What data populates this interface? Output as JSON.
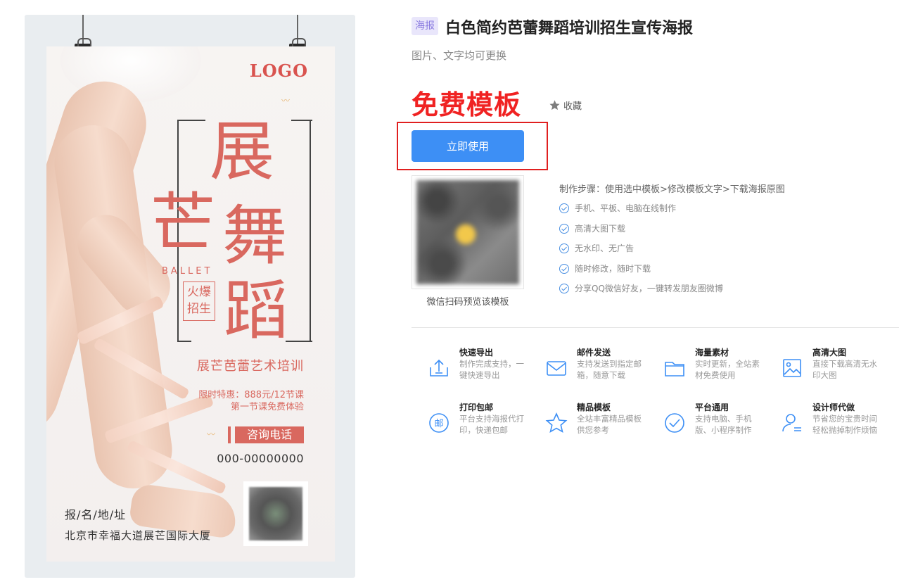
{
  "poster": {
    "logo": "LOGO",
    "title_chars": [
      "展",
      "芒",
      "舞",
      "蹈"
    ],
    "ballet": "BALLET",
    "hot_lines": [
      "火爆",
      "招生"
    ],
    "subtitle": "展芒芭蕾艺术培训",
    "promo_1": "限时特惠：888元/12节课",
    "promo_2": "第一节课免费体验",
    "tel_label": "咨询电话",
    "tel_number": "000-00000000",
    "addr_label": "报/名/地/址",
    "addr_text": "北京市幸福大道展芒国际大厦"
  },
  "info": {
    "tag": "海报",
    "title": "白色简约芭蕾舞蹈培训招生宣传海报",
    "subtitle": "图片、文字均可更换",
    "free_label": "免费模板",
    "fav_label": "收藏",
    "use_button": "立即使用",
    "qr_caption": "微信扫码预览该模板",
    "steps_head": "制作步骤：使用选中模板>修改模板文字>下载海报原图",
    "steps": [
      "手机、平板、电脑在线制作",
      "高清大图下载",
      "无水印、无广告",
      "随时修改，随时下载",
      "分享QQ微信好友，一键转发朋友圈微博"
    ]
  },
  "features": [
    {
      "title": "快速导出",
      "desc": "制作完成支持，一键快速导出",
      "icon": "export-icon"
    },
    {
      "title": "邮件发送",
      "desc": "支持发送到指定邮箱，随意下载",
      "icon": "mail-icon"
    },
    {
      "title": "海量素材",
      "desc": "实时更新，全站素材免费使用",
      "icon": "folder-icon"
    },
    {
      "title": "高清大图",
      "desc": "直接下载高清无水印大图",
      "icon": "image-icon"
    },
    {
      "title": "打印包邮",
      "desc": "平台支持海报代打印，快递包邮",
      "icon": "post-icon"
    },
    {
      "title": "精品模板",
      "desc": "全站丰富精品模板供您参考",
      "icon": "star-icon"
    },
    {
      "title": "平台通用",
      "desc": "支持电脑、手机版、小程序制作",
      "icon": "check-circle-icon"
    },
    {
      "title": "设计师代做",
      "desc": "节省您的宝贵时间轻松抛掉制作烦恼",
      "icon": "designer-icon"
    }
  ],
  "colors": {
    "accent_blue": "#3d8ff5",
    "free_red": "#f02222",
    "poster_coral": "#d9685f",
    "icon_blue": "#3d8ff5"
  }
}
